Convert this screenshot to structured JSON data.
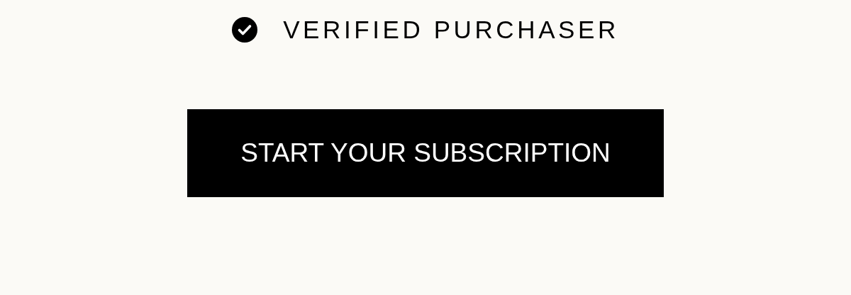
{
  "badge": {
    "label": "VERIFIED PURCHASER",
    "verified": true
  },
  "button": {
    "label": "START YOUR SUBSCRIPTION"
  }
}
